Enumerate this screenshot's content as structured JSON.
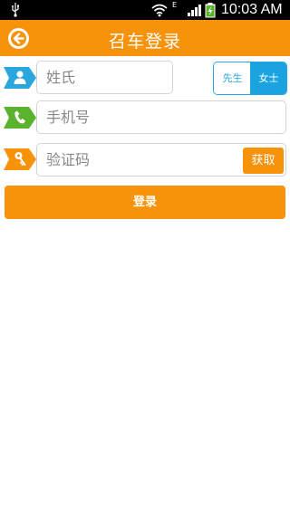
{
  "status_bar": {
    "network_type": "E",
    "time": "10:03 AM",
    "icons": [
      "usb-icon",
      "wifi-icon",
      "signal-icon",
      "battery-charging-icon"
    ]
  },
  "header": {
    "title": "召车登录",
    "back_icon": "back-arrow-icon"
  },
  "form": {
    "surname": {
      "placeholder": "姓氏",
      "icon": "person-icon",
      "icon_color": "#29a6dd"
    },
    "gender": {
      "options": [
        "先生",
        "女士"
      ],
      "selected": "女士"
    },
    "phone": {
      "placeholder": "手机号",
      "icon": "phone-icon",
      "icon_color": "#5ab32c"
    },
    "code": {
      "placeholder": "验证码",
      "icon": "key-icon",
      "icon_color": "#f7930a",
      "get_label": "获取"
    }
  },
  "login_label": "登录",
  "colors": {
    "accent": "#f7930a",
    "blue": "#29a6dd",
    "green": "#5ab32c"
  }
}
